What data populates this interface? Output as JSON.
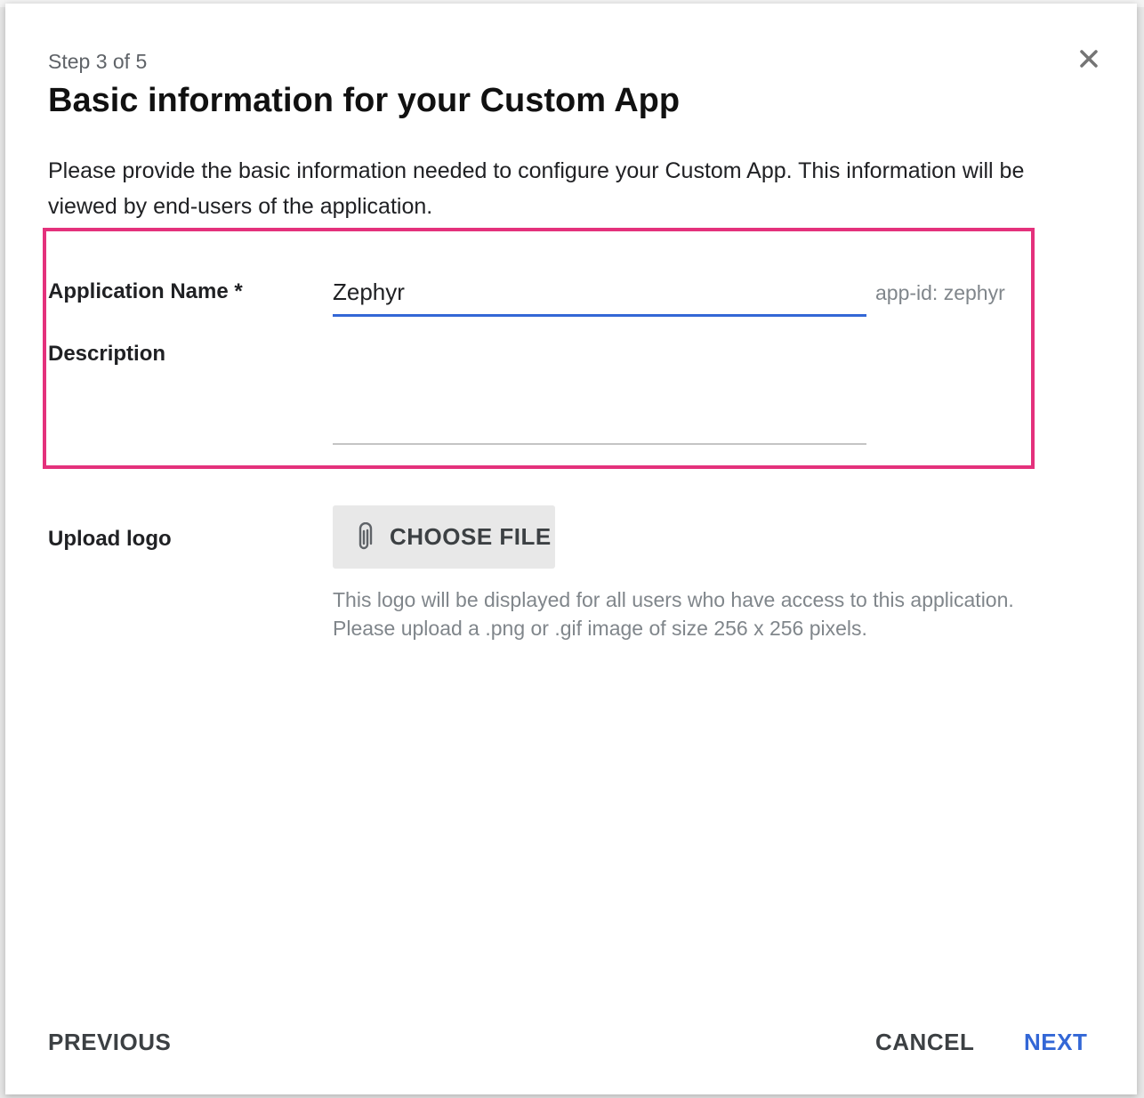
{
  "dialog": {
    "step": "Step 3 of 5",
    "title": "Basic information for your Custom App",
    "intro": "Please provide the basic information needed to configure your Custom App. This information will be viewed by end-users of the application.",
    "close_icon": "close-icon"
  },
  "form": {
    "app_name_label": "Application Name *",
    "app_name_value": "Zephyr",
    "app_id": "app-id:  zephyr",
    "description_label": "Description",
    "description_value": "",
    "upload_label": "Upload logo",
    "choose_file_label": "CHOOSE FILE",
    "choose_file_icon": "paperclip-icon",
    "hint_line1": "This logo will be displayed for all users who have access to this application.",
    "hint_line2": "Please upload a .png or .gif image of size 256 x 256 pixels."
  },
  "footer": {
    "previous_label": "PREVIOUS",
    "cancel_label": "CANCEL",
    "next_label": "NEXT"
  },
  "colors": {
    "accent": "#3367d6",
    "highlight": "#e4317c",
    "muted_text": "#80868b"
  }
}
